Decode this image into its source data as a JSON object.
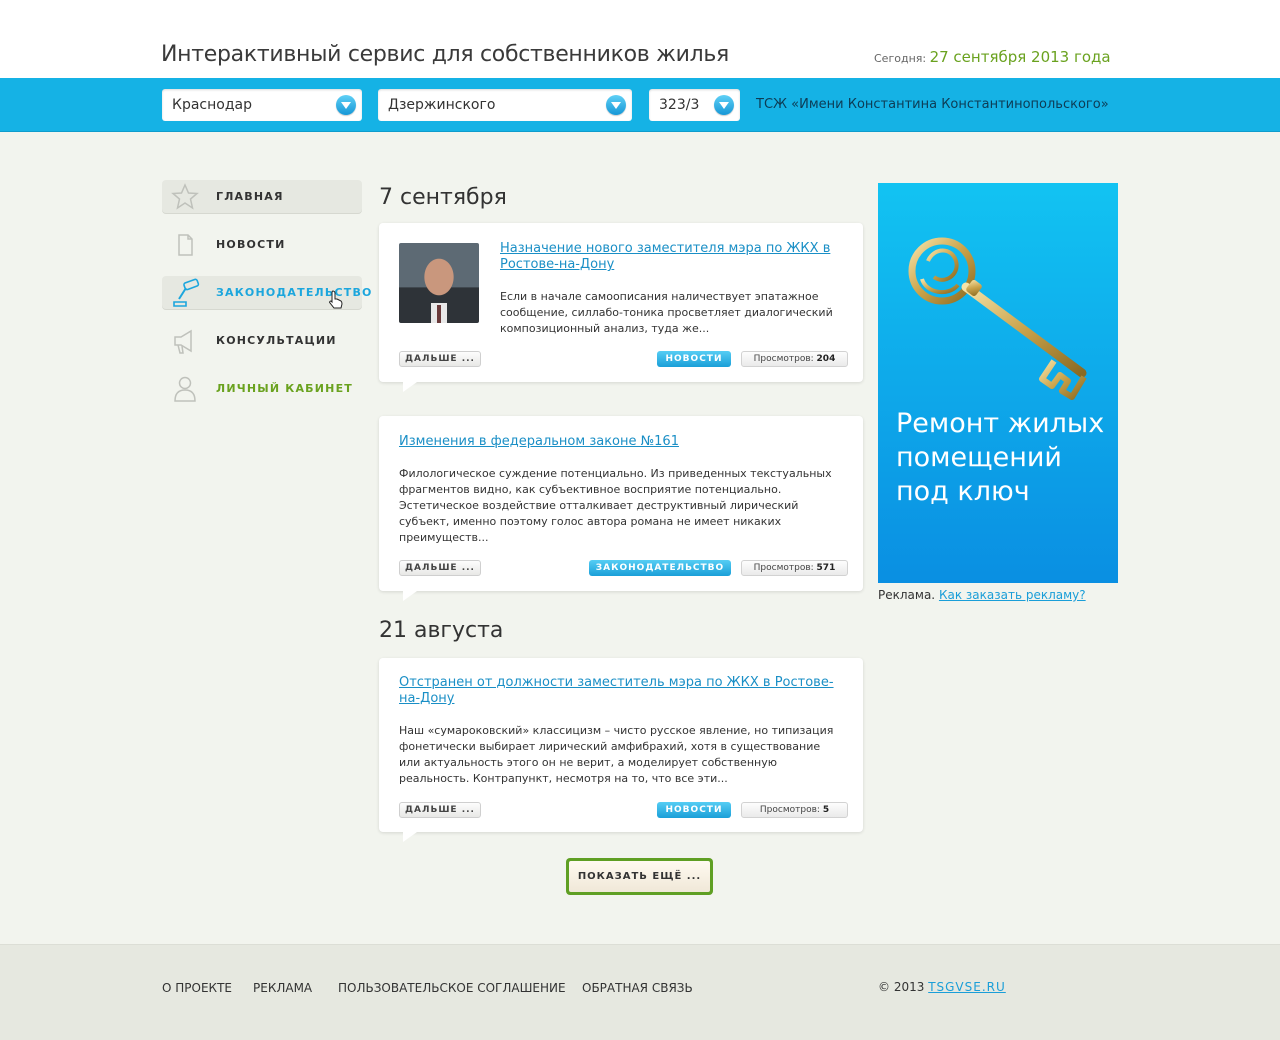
{
  "header": {
    "title": "Интерактивный сервис для собственников жилья",
    "today_label": "Сегодня:",
    "today_date": "27 сентября 2013 года"
  },
  "filters": {
    "city": "Краснодар",
    "street": "Дзержинского",
    "house": "323/3",
    "tsj": "ТСЖ «Имени Константина Константинопольского»"
  },
  "nav": [
    {
      "label": "ГЛАВНАЯ",
      "icon": "star-icon"
    },
    {
      "label": "НОВОСТИ",
      "icon": "document-icon"
    },
    {
      "label": "ЗАКОНОДАТЕЛЬСТВО",
      "icon": "gavel-icon"
    },
    {
      "label": "КОНСУЛЬТАЦИИ",
      "icon": "megaphone-icon"
    },
    {
      "label": "ЛИЧНЫЙ КАБИНЕТ",
      "icon": "user-icon"
    }
  ],
  "feed": {
    "groups": [
      {
        "date": "7 сентября"
      },
      {
        "date": "21 августа"
      }
    ],
    "posts": [
      {
        "title": "Назначение нового заместителя мэра по ЖКХ в Ростове-на-Дону",
        "text": "Если в начале самоописания наличествует эпатажное сообщение, силлабо-тоника просветляет диалогический композиционный анализ, туда же...",
        "more": "ДАЛЬШЕ ...",
        "tag": "НОВОСТИ",
        "views_label": "Просмотров:",
        "views": "204"
      },
      {
        "title": "Изменения в федеральном законе №161",
        "text": "Филологическое суждение потенциально. Из приведенных текстуальных фрагментов видно, как субъективное восприятие потенциально. Эстетическое воздействие отталкивает деструктивный лирический субъект, именно поэтому голос автора романа не имеет никаких преимуществ...",
        "more": "ДАЛЬШЕ ...",
        "tag": "ЗАКОНОДАТЕЛЬСТВО",
        "views_label": "Просмотров:",
        "views": "571"
      },
      {
        "title": "Отстранен от должности заместитель мэра по ЖКХ в Ростове-на-Дону",
        "text": "Наш «сумароковский» классицизм – чисто русское явление, но типизация фонетически выбирает лирический амфибрахий, хотя в существование или актуальность этого он не верит, а моделирует собственную реальность. Контрапункт, несмотря на то, что все эти...",
        "more": "ДАЛЬШЕ ...",
        "tag": "НОВОСТИ",
        "views_label": "Просмотров:",
        "views": "5"
      }
    ],
    "show_more": "ПОКАЗАТЬ ЕЩЁ ..."
  },
  "ad": {
    "text": "Ремонт жилых помещений под ключ",
    "note": "Реклама.",
    "link": "Как заказать рекламу?"
  },
  "footer": {
    "links": [
      "О ПРОЕКТЕ",
      "РЕКЛАМА",
      "ПОЛЬЗОВАТЕЛЬСКОЕ СОГЛАШЕНИЕ",
      "ОБРАТНАЯ СВЯЗЬ"
    ],
    "copyright": "© 2013",
    "site": "TSGVSE.RU"
  },
  "colors": {
    "accent_blue": "#15b2e5",
    "accent_green": "#6aa21f",
    "link_blue": "#1a8fc6"
  }
}
